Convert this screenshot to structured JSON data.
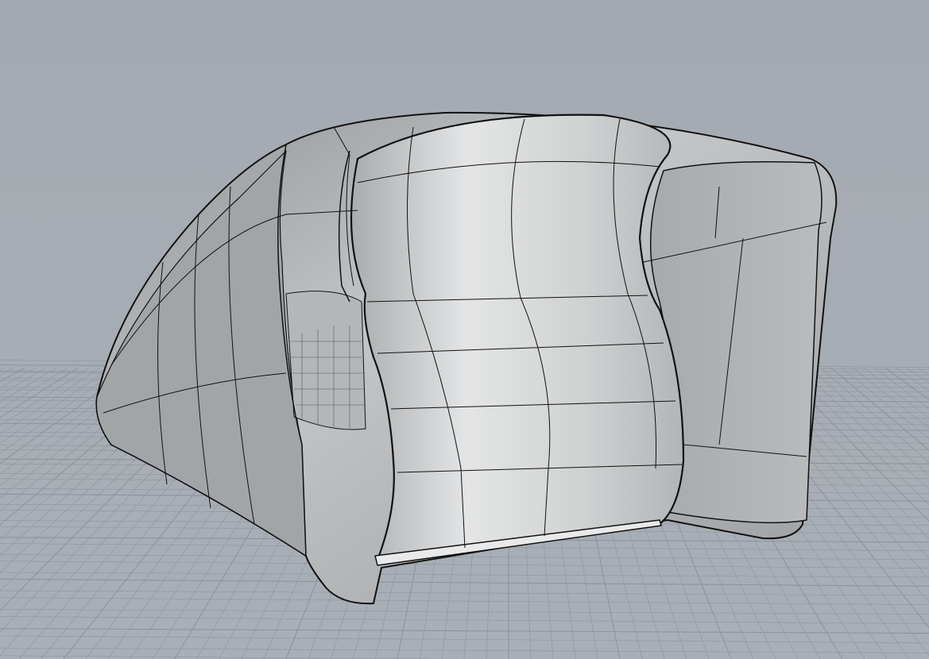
{
  "viewport": {
    "view": "perspective",
    "display_mode": "shaded",
    "background_color": "#a6acb3",
    "grid_color": "#8e949b",
    "surface_color": "#c9cbcd",
    "edge_color": "#111111"
  }
}
